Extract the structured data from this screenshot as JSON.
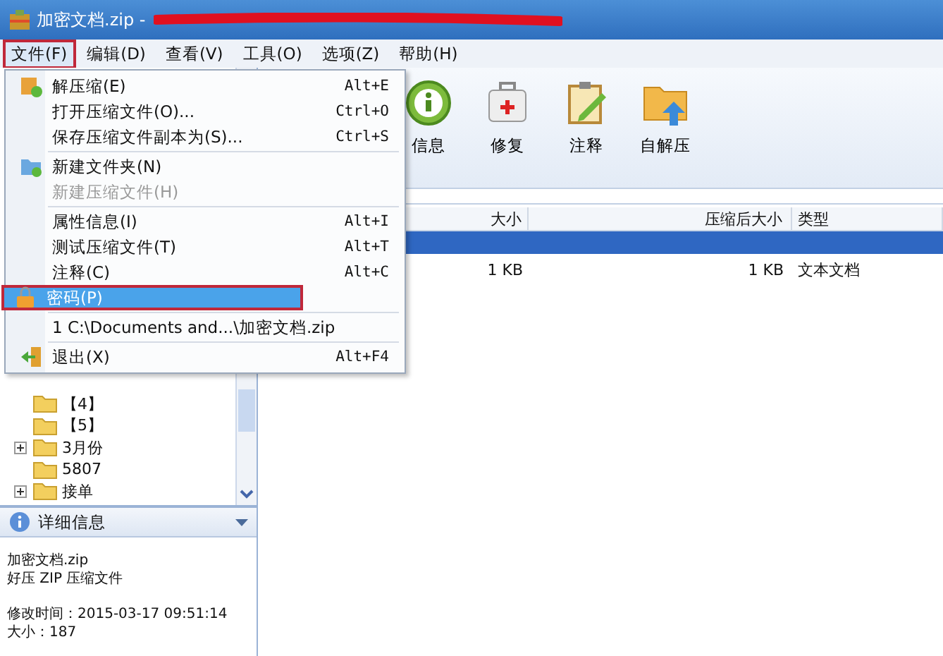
{
  "window": {
    "title": "加密文档.zip -"
  },
  "menubar": [
    {
      "label": "文件(F)",
      "selected": true,
      "highlighted": true
    },
    {
      "label": "编辑(D)",
      "selected": false,
      "highlighted": false
    },
    {
      "label": "查看(V)",
      "selected": false,
      "highlighted": false
    },
    {
      "label": "工具(O)",
      "selected": false,
      "highlighted": false
    },
    {
      "label": "选项(Z)",
      "selected": false,
      "highlighted": false
    },
    {
      "label": "帮助(H)",
      "selected": false,
      "highlighted": false
    }
  ],
  "file_menu": [
    {
      "kind": "item",
      "label": "解压缩(E)",
      "shortcut": "Alt+E",
      "disabled": false,
      "selected": false,
      "highlighted": false
    },
    {
      "kind": "item",
      "label": "打开压缩文件(O)...",
      "shortcut": "Ctrl+O",
      "disabled": false,
      "selected": false,
      "highlighted": false
    },
    {
      "kind": "item",
      "label": "保存压缩文件副本为(S)...",
      "shortcut": "Ctrl+S",
      "disabled": false,
      "selected": false,
      "highlighted": false
    },
    {
      "kind": "separator"
    },
    {
      "kind": "item",
      "label": "新建文件夹(N)",
      "disabled": false,
      "selected": false,
      "highlighted": false
    },
    {
      "kind": "item",
      "label": "新建压缩文件(H)",
      "disabled": true,
      "selected": false,
      "highlighted": false
    },
    {
      "kind": "separator"
    },
    {
      "kind": "item",
      "label": "属性信息(I)",
      "shortcut": "Alt+I",
      "disabled": false,
      "selected": false,
      "highlighted": false
    },
    {
      "kind": "item",
      "label": "测试压缩文件(T)",
      "shortcut": "Alt+T",
      "disabled": false,
      "selected": false,
      "highlighted": false
    },
    {
      "kind": "item",
      "label": "注释(C)",
      "shortcut": "Alt+C",
      "disabled": false,
      "selected": false,
      "highlighted": false
    },
    {
      "kind": "item",
      "label": "密码(P)",
      "disabled": false,
      "selected": true,
      "highlighted": true
    },
    {
      "kind": "separator"
    },
    {
      "kind": "item",
      "label": "1 C:\\Documents and...\\加密文档.zip",
      "disabled": false,
      "selected": false,
      "highlighted": false
    },
    {
      "kind": "separator"
    },
    {
      "kind": "item",
      "label": "退出(X)",
      "shortcut": "Alt+F4",
      "disabled": false,
      "selected": false,
      "highlighted": false
    }
  ],
  "toolbar": [
    {
      "label": "信息"
    },
    {
      "label": "修复"
    },
    {
      "label": "注释"
    },
    {
      "label": "自解压"
    }
  ],
  "table": {
    "columns": [
      "大小",
      "压缩后大小",
      "类型"
    ],
    "rows": [
      {
        "cells": [
          "",
          "",
          ""
        ],
        "selected": true
      },
      {
        "cells": [
          "1 KB",
          "1 KB",
          "文本文档"
        ],
        "selected": false
      }
    ]
  },
  "folder_tree": [
    {
      "label": "【4】",
      "expandable": false
    },
    {
      "label": "【5】",
      "expandable": false
    },
    {
      "label": "3月份",
      "expandable": true
    },
    {
      "label": "5807",
      "expandable": false
    },
    {
      "label": "接单",
      "expandable": true
    }
  ],
  "details": {
    "title": "详细信息",
    "file_lines": [
      "加密文档.zip",
      "好压 ZIP 压缩文件"
    ],
    "info_lines": [
      "修改时间：2015-03-17 09:51:14",
      "大小：187"
    ]
  }
}
